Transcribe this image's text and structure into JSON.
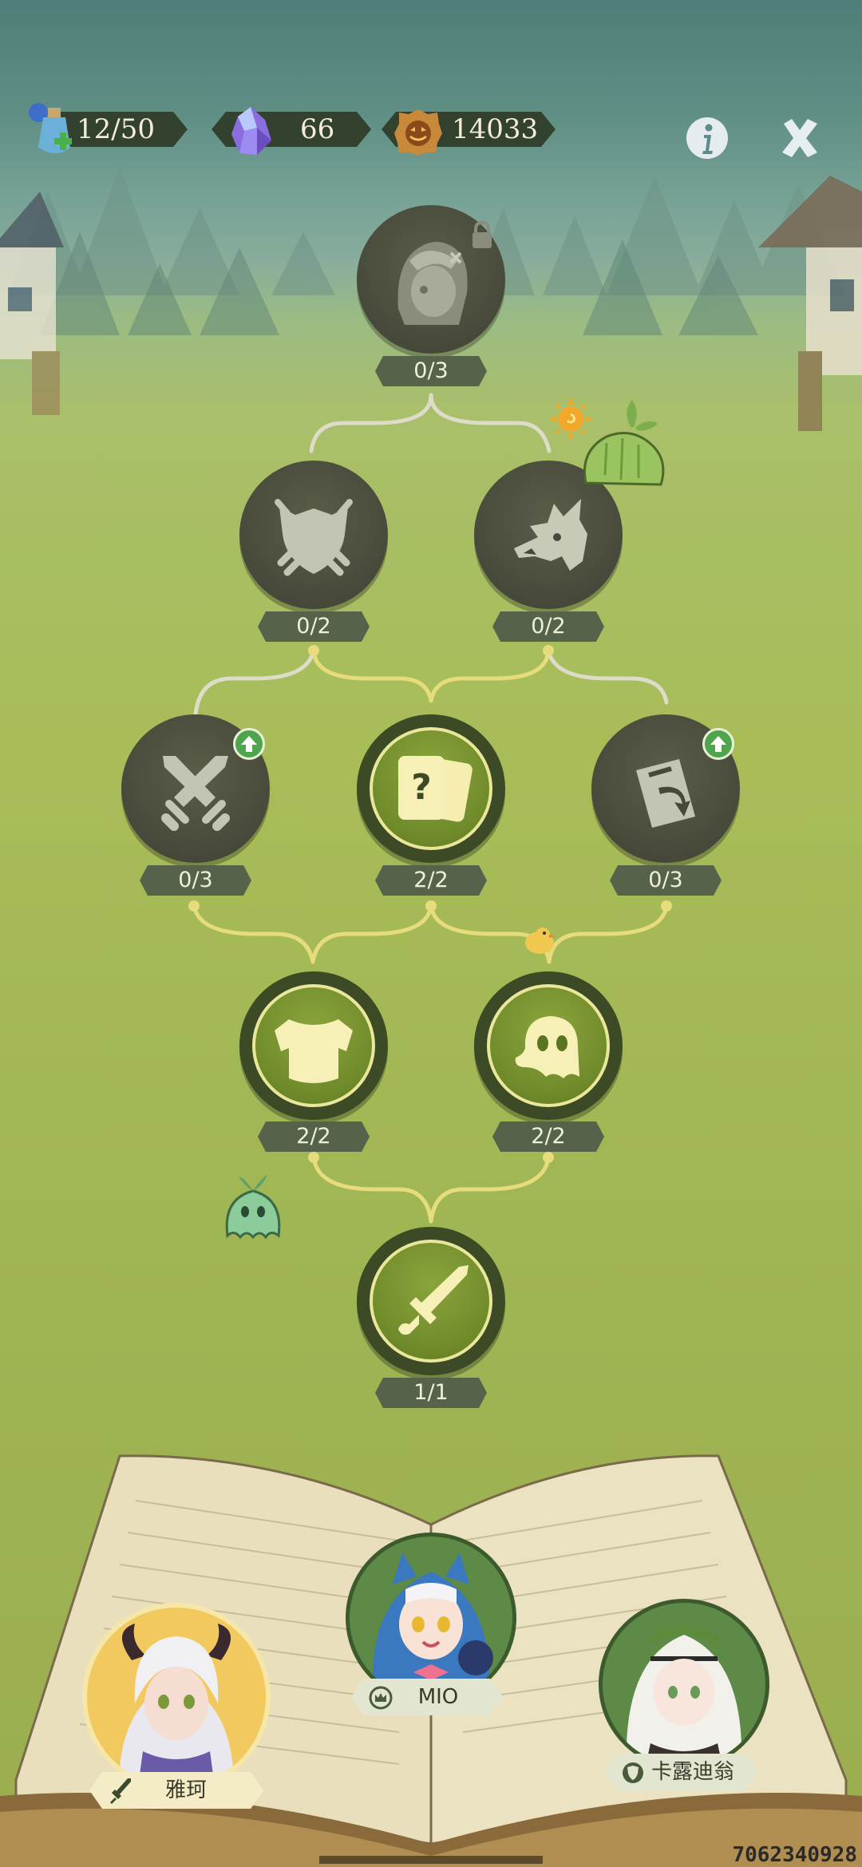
{
  "hud": {
    "stamina": "12/50",
    "crystals": "66",
    "coins": "14033",
    "info_icon": "info-icon",
    "close_icon": "close-icon"
  },
  "skill_tree": {
    "nodes": [
      {
        "id": "boss-portrait",
        "icon": "character-portrait-icon",
        "state": "locked",
        "count": "0/3",
        "has_lock": true
      },
      {
        "id": "shield",
        "icon": "shield-icon",
        "state": "locked",
        "count": "0/2"
      },
      {
        "id": "dragon",
        "icon": "dragon-icon",
        "state": "locked",
        "count": "0/2"
      },
      {
        "id": "crossed-swords",
        "icon": "crossed-swords-icon",
        "state": "locked",
        "count": "0/3",
        "upgrade": true
      },
      {
        "id": "mystery-card",
        "icon": "mystery-card-icon",
        "state": "done",
        "count": "2/2"
      },
      {
        "id": "card-return",
        "icon": "card-return-icon",
        "state": "locked",
        "count": "0/3",
        "upgrade": true
      },
      {
        "id": "armor",
        "icon": "armor-icon",
        "state": "done",
        "count": "2/2"
      },
      {
        "id": "ghost",
        "icon": "ghost-icon",
        "state": "done",
        "count": "2/2"
      },
      {
        "id": "sword",
        "icon": "sword-icon",
        "state": "done",
        "count": "1/1"
      }
    ]
  },
  "party": [
    {
      "name": "雅珂",
      "role_icon": "sword-icon",
      "selected": true
    },
    {
      "name": "MIO",
      "role_icon": "crown-icon",
      "selected": false
    },
    {
      "name": "卡露迪翁",
      "role_icon": "shield-icon",
      "selected": false
    }
  ],
  "uid": "7062340928",
  "colors": {
    "node_locked": "#4a4c3c",
    "node_done": "#78922c",
    "ring": "#e8e79a",
    "path_inactive": "#d8d8c8",
    "path_active": "#e6dc7c"
  }
}
